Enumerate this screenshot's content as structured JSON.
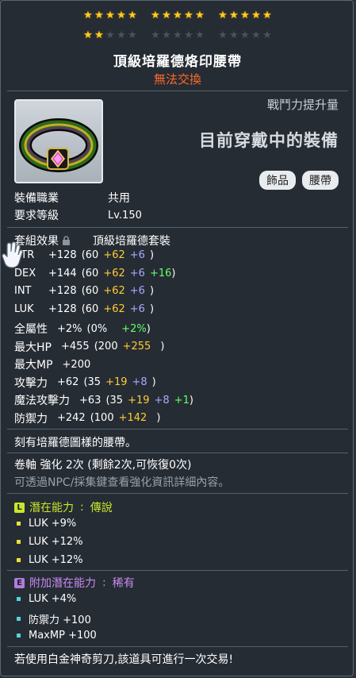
{
  "stars": {
    "row1": [
      [
        1,
        1,
        1,
        1,
        1
      ],
      [
        1,
        1,
        1,
        1,
        1
      ],
      [
        1,
        1,
        1,
        1,
        1
      ]
    ],
    "row2": [
      [
        1,
        1,
        0,
        0,
        0
      ],
      [
        0,
        0,
        0,
        0,
        0
      ],
      [
        0,
        0,
        0,
        0,
        0
      ]
    ],
    "color_on": "#ffcc22",
    "color_off": "#4b525a"
  },
  "item": {
    "name": "頂級培羅德烙印腰帶",
    "trade_status": "無法交換",
    "power_label": "戰鬥力提升量",
    "equipped_text": "目前穿戴中的裝備",
    "tags": [
      "飾品",
      "腰帶"
    ],
    "icon": "belt-icon"
  },
  "requirements": {
    "job_label": "裝備職業",
    "job_value": "共用",
    "level_label": "要求等級",
    "level_value": "Lv.150"
  },
  "set": {
    "label": "套組效果",
    "icon": "lock-icon",
    "name": "頂級培羅德套裝"
  },
  "stats": [
    {
      "name": "STR",
      "total": "+128",
      "base": "(60",
      "bonus": [
        "+62",
        "+6"
      ],
      "extra": "",
      "close": ")"
    },
    {
      "name": "DEX",
      "total": "+144",
      "base": "(60",
      "bonus": [
        "+62",
        "+6"
      ],
      "extra": "+16",
      "close": ")"
    },
    {
      "name": "INT",
      "total": "+128",
      "base": "(60",
      "bonus": [
        "+62",
        "+6"
      ],
      "extra": "",
      "close": ")"
    },
    {
      "name": "LUK",
      "total": "+128",
      "base": "(60",
      "bonus": [
        "+62",
        "+6"
      ],
      "extra": "",
      "close": ")"
    },
    {
      "name": "全屬性",
      "total": "+2%",
      "base": "(0%",
      "bonus": [
        "",
        ""
      ],
      "extra": "+2%",
      "close": ")"
    },
    {
      "name": "最大HP",
      "total": "+455",
      "base": "(200",
      "bonus": [
        "+255",
        ""
      ],
      "extra": "",
      "close": ")"
    },
    {
      "name": "最大MP",
      "total": "+200",
      "base": "",
      "bonus": [
        "",
        ""
      ],
      "extra": "",
      "close": ""
    },
    {
      "name": "攻擊力",
      "total": "+62",
      "base": "(35",
      "bonus": [
        "+19",
        "+8"
      ],
      "extra": "",
      "close": ")"
    },
    {
      "name": "魔法攻擊力",
      "total": "+63",
      "base": "(35",
      "bonus": [
        "+19",
        "+8"
      ],
      "extra": "+1",
      "close": ")"
    },
    {
      "name": "防禦力",
      "total": "+242",
      "base": "(100",
      "bonus": [
        "+142",
        ""
      ],
      "extra": "",
      "close": ")"
    }
  ],
  "description": "刻有培羅德圖樣的腰帶。",
  "scroll": {
    "text": "卷軸 強化 2次 (剩餘2次,可恢復0次)",
    "hint": "可透過NPC/採集鍵查看強化資訊詳細內容。"
  },
  "potential": {
    "badge": "L",
    "badge_color": "#c8e62a",
    "label": "潛在能力",
    "sep": ":",
    "grade": "傳說",
    "lines": [
      "LUK +9%",
      "LUK +12%",
      "LUK +12%"
    ]
  },
  "additional": {
    "badge": "E",
    "badge_color": "#b07be0",
    "label": "附加潛在能力",
    "sep": ":",
    "grade": "稀有",
    "lines": [
      "LUK +4%",
      "防禦力 +100",
      "MaxMP +100"
    ]
  },
  "footer": "若使用白金神奇剪刀,該道具可進行一次交易!"
}
